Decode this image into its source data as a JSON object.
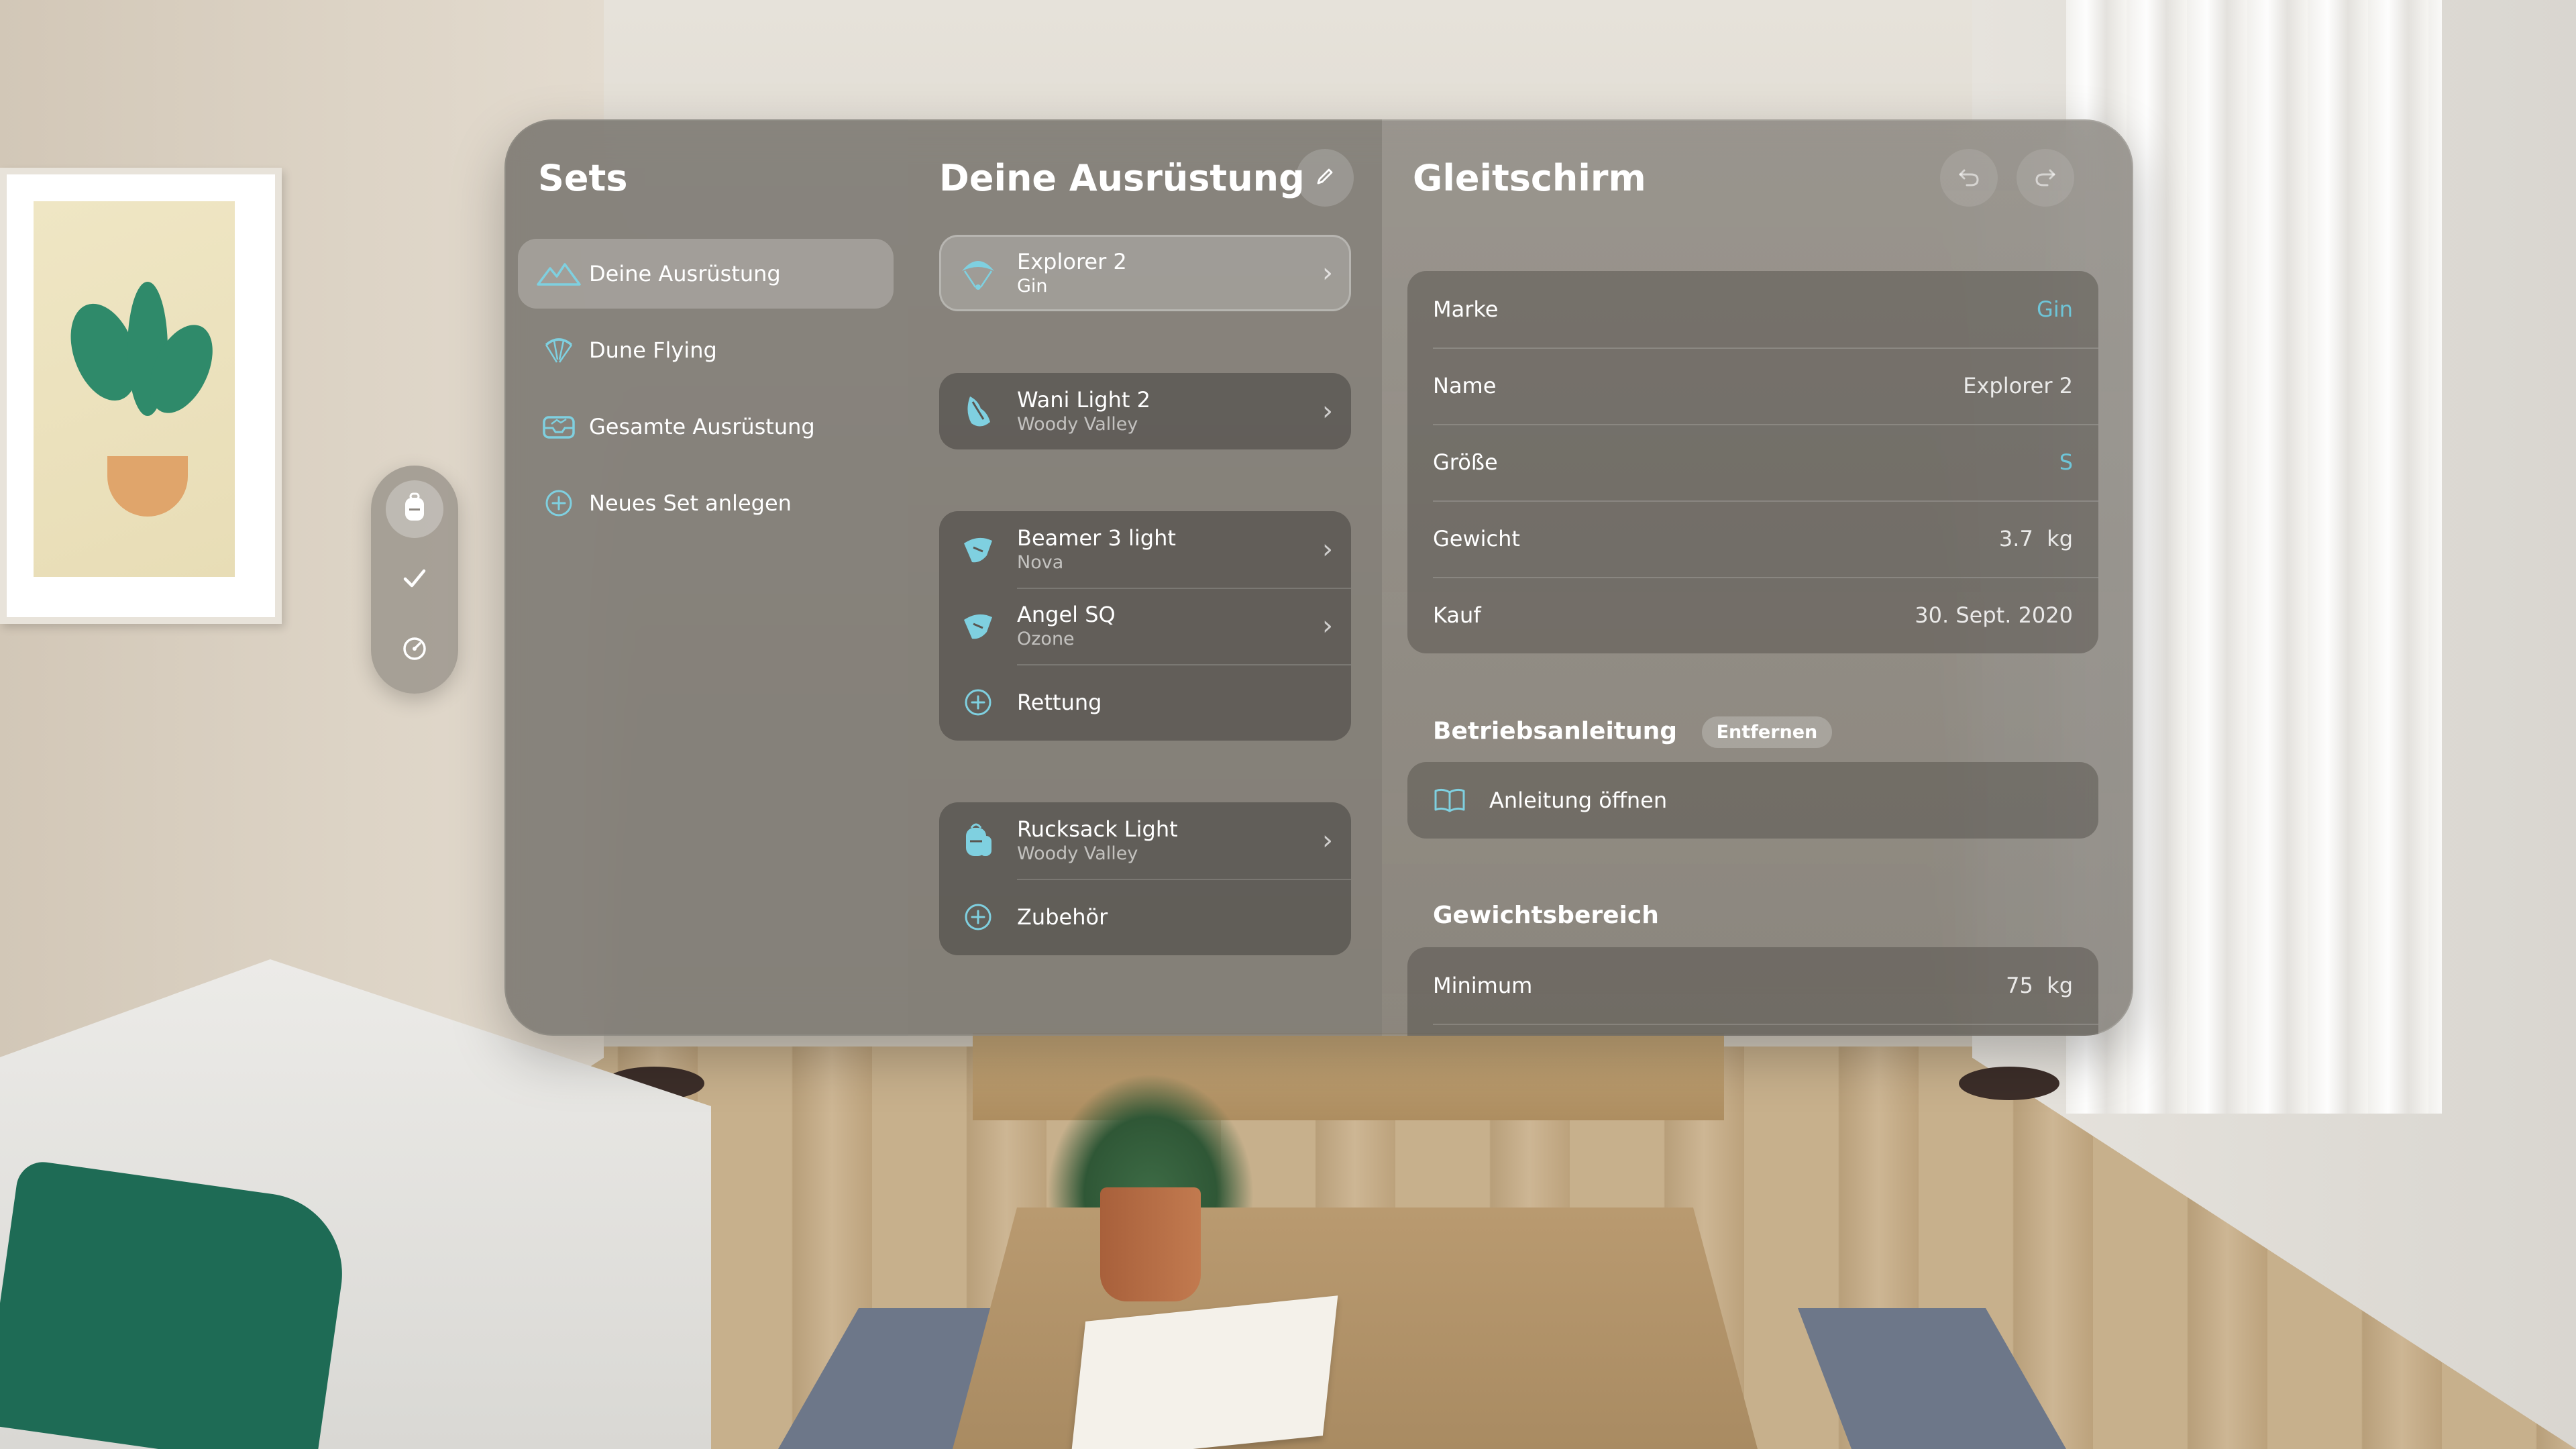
{
  "sidebar": {
    "title": "Sets",
    "items": [
      {
        "label": "Deine Ausrüstung",
        "icon": "mountains-icon",
        "selected": true
      },
      {
        "label": "Dune Flying",
        "icon": "paraglider-icon",
        "selected": false
      },
      {
        "label": "Gesamte Ausrüstung",
        "icon": "tray-icon",
        "selected": false
      },
      {
        "label": "Neues Set anlegen",
        "icon": "plus-circle-icon",
        "selected": false
      }
    ]
  },
  "ornament": {
    "tabs": [
      {
        "icon": "backpack-icon",
        "selected": true
      },
      {
        "icon": "checkmark-icon",
        "selected": false
      },
      {
        "icon": "gauge-icon",
        "selected": false
      }
    ]
  },
  "middle": {
    "title": "Deine Ausrüstung",
    "edit_icon": "pencil-icon",
    "groups": [
      {
        "rows": [
          {
            "title": "Explorer 2",
            "subtitle": "Gin",
            "icon": "glider-icon",
            "selected": true
          }
        ]
      },
      {
        "rows": [
          {
            "title": "Wani Light 2",
            "subtitle": "Woody Valley",
            "icon": "harness-icon"
          }
        ]
      },
      {
        "rows": [
          {
            "title": "Beamer 3 light",
            "subtitle": "Nova",
            "icon": "reserve-icon"
          },
          {
            "title": "Angel SQ",
            "subtitle": "Ozone",
            "icon": "reserve-icon"
          },
          {
            "title": "Rettung",
            "icon": "plus-circle-icon",
            "add": true
          }
        ]
      },
      {
        "rows": [
          {
            "title": "Rucksack Light",
            "subtitle": "Woody Valley",
            "icon": "backpack-icon"
          },
          {
            "title": "Zubehör",
            "icon": "plus-circle-icon",
            "add": true
          }
        ]
      }
    ]
  },
  "detail": {
    "title": "Gleitschirm",
    "undo_icon": "undo-icon",
    "redo_icon": "redo-icon",
    "fields": [
      {
        "key": "Marke",
        "value": "Gin",
        "accent": true
      },
      {
        "key": "Name",
        "value": "Explorer 2"
      },
      {
        "key": "Größe",
        "value": "S",
        "accent": true
      },
      {
        "key": "Gewicht",
        "value": "3.7  kg"
      },
      {
        "key": "Kauf",
        "value": "30. Sept. 2020"
      }
    ],
    "manual": {
      "heading": "Betriebsanleitung",
      "badge": "Entfernen",
      "open_label": "Anleitung öffnen"
    },
    "weight_range": {
      "heading": "Gewichtsbereich",
      "rows": [
        {
          "key": "Minimum",
          "value": "75  kg"
        }
      ]
    }
  },
  "colors": {
    "accent": "#6ec5d8"
  }
}
